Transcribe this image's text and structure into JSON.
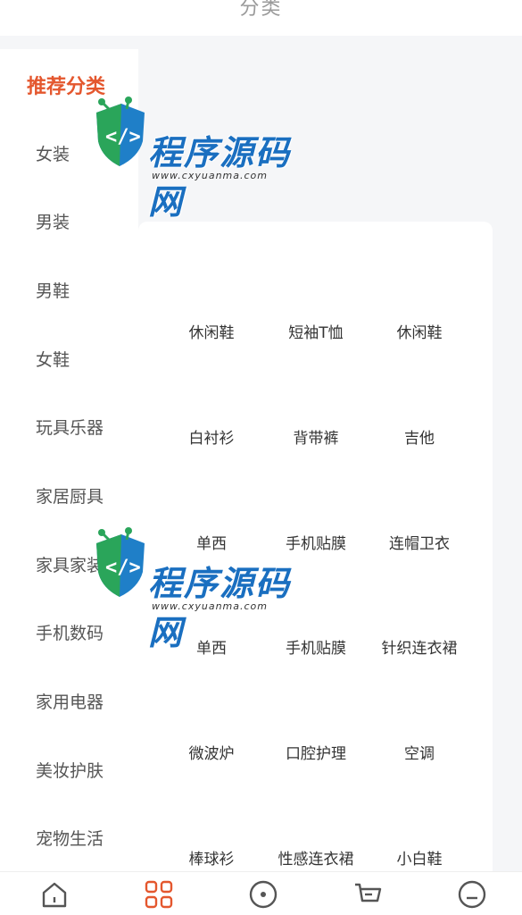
{
  "header": {
    "title": "分类"
  },
  "sidebar": {
    "items": [
      {
        "label": "推荐分类",
        "active": true
      },
      {
        "label": "女装"
      },
      {
        "label": "男装"
      },
      {
        "label": "男鞋"
      },
      {
        "label": "女鞋"
      },
      {
        "label": "玩具乐器"
      },
      {
        "label": "家居厨具"
      },
      {
        "label": "家具家装"
      },
      {
        "label": "手机数码"
      },
      {
        "label": "家用电器"
      },
      {
        "label": "美妆护肤"
      },
      {
        "label": "宠物生活"
      }
    ]
  },
  "content": {
    "items": [
      "休闲鞋",
      "短袖T恤",
      "休闲鞋",
      "白衬衫",
      "背带裤",
      "吉他",
      "单西",
      "手机贴膜",
      "连帽卫衣",
      "单西",
      "手机贴膜",
      "针织连衣裙",
      "微波炉",
      "口腔护理",
      "空调",
      "棒球衫",
      "性感连衣裙",
      "小白鞋"
    ]
  },
  "watermark": {
    "text": "程序源码网",
    "url": "www.cxyuanma.com"
  },
  "tabbar": {
    "tabs": [
      {
        "icon": "home-icon",
        "active": false
      },
      {
        "icon": "category-grid-icon",
        "active": true
      },
      {
        "icon": "discover-icon",
        "active": false
      },
      {
        "icon": "cart-icon",
        "active": false
      },
      {
        "icon": "profile-icon",
        "active": false
      }
    ]
  },
  "colors": {
    "accent": "#e4572e",
    "inactive_icon": "#555555",
    "background": "#f5f6f8"
  }
}
